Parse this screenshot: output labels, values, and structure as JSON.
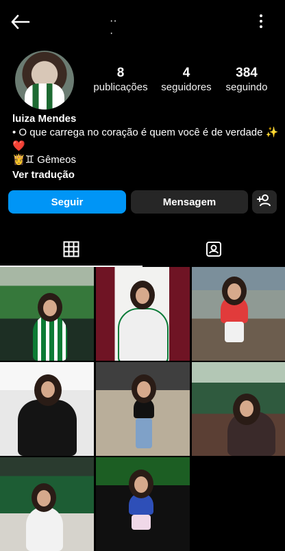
{
  "header": {
    "title_partial": "·· ·"
  },
  "profile": {
    "avatar_alt": "avatar",
    "stats": [
      {
        "value": "8",
        "label": "publicações"
      },
      {
        "value": "4",
        "label": "seguidores"
      },
      {
        "value": "384",
        "label": "seguindo"
      }
    ],
    "name": "luiza Mendes",
    "bio_line1": "• O que carrega no coração é quem você é de verdade ✨",
    "bio_line2": "❤️",
    "bio_line3": "👸♊ Gêmeos",
    "translate": "Ver tradução"
  },
  "actions": {
    "follow": "Seguir",
    "message": "Mensagem"
  },
  "tabs": [
    "grid",
    "tagged"
  ],
  "icons": {
    "back": "back-arrow-icon",
    "more": "more-vert-icon",
    "add_user": "add-user-icon",
    "grid": "grid-icon",
    "tagged": "tagged-icon"
  }
}
